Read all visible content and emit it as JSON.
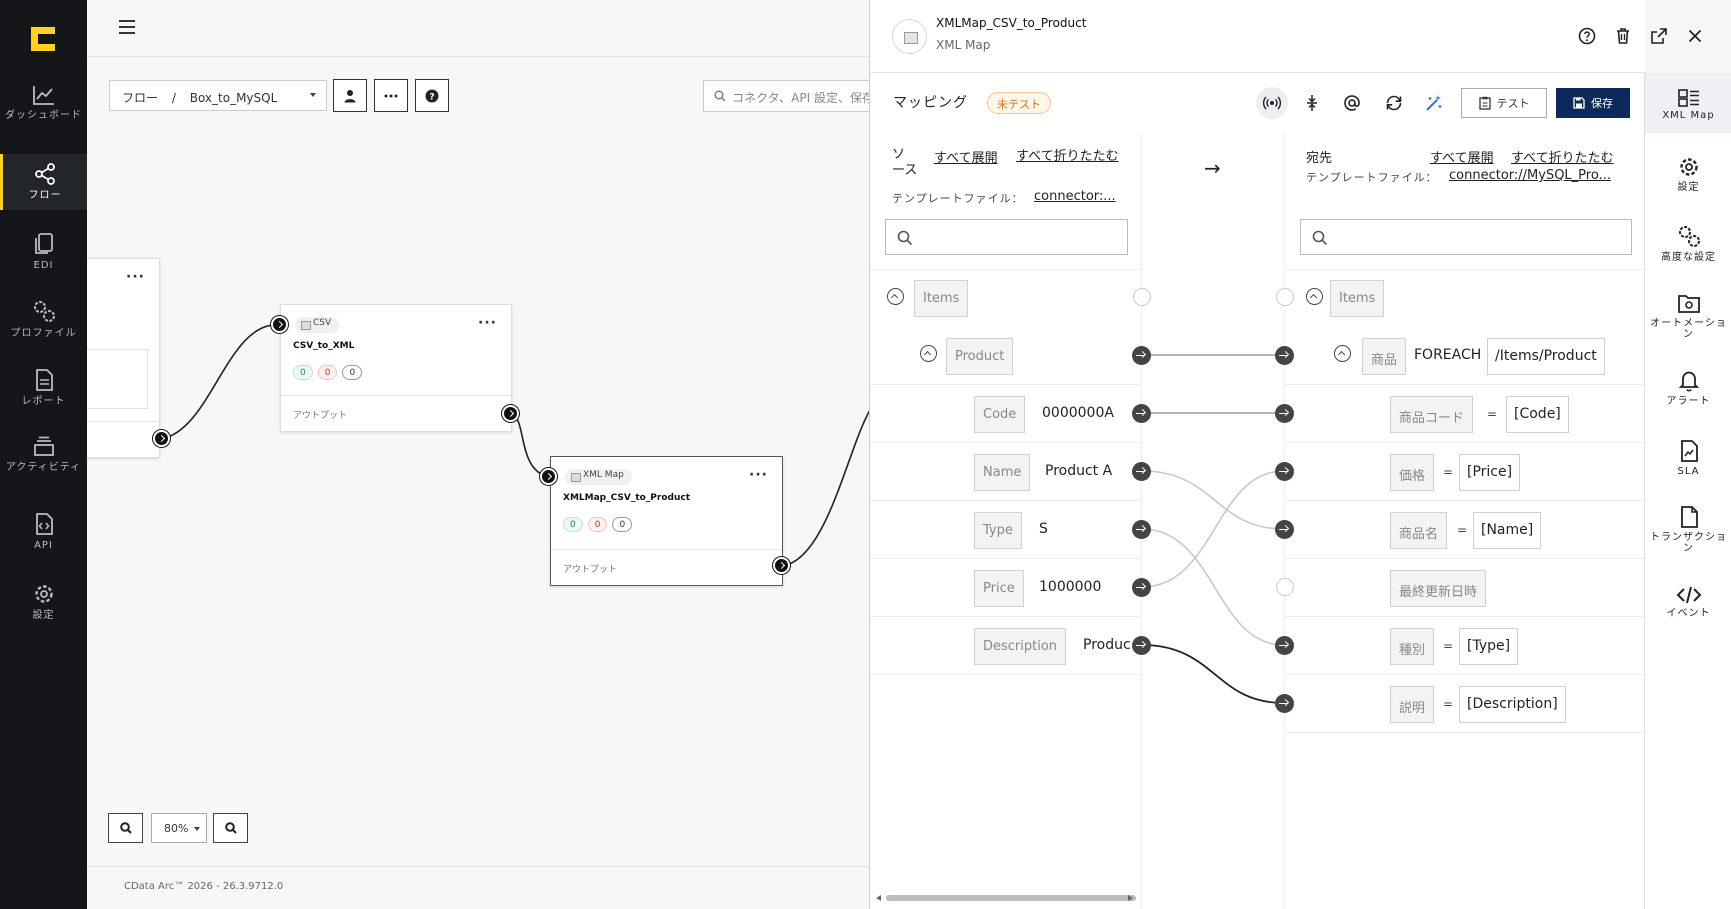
{
  "nav": {
    "items": [
      {
        "label": "ダッシュボード"
      },
      {
        "label": "フロー"
      },
      {
        "label": "EDI"
      },
      {
        "label": "プロファイル"
      },
      {
        "label": "レポート"
      },
      {
        "label": "アクティビティ"
      },
      {
        "label": "API"
      },
      {
        "label": "設定"
      }
    ],
    "active": "フロー"
  },
  "canvas": {
    "breadcrumb": {
      "root": "フロー",
      "separator": "/",
      "flow": "Box_to_MySQL"
    },
    "search_placeholder": "コネクタ、API 設定、保存",
    "zoom": "80%",
    "version": "CData Arc™ 2026 - 26.3.9712.0",
    "nodes": [
      {
        "type": "CSV",
        "title": "CSV_to_XML",
        "badges": [
          "0",
          "0",
          "0"
        ],
        "output": "アウトプット"
      },
      {
        "type": "XML Map",
        "title": "XMLMap_CSV_to_Product",
        "badges": [
          "0",
          "0",
          "0"
        ],
        "output": "アウトプット"
      }
    ]
  },
  "drawer": {
    "title": "XMLMap_CSV_to_Product",
    "subtitle": "XML Map",
    "mapping_title": "マッピング",
    "status_badge": "未テスト",
    "test_label": "テスト",
    "save_label": "保存",
    "source": {
      "heading": "ソース",
      "expand_all": "すべて展開",
      "collapse_all": "すべて折りたたむ",
      "template_label": "テンプレートファイル：",
      "template_value": "connector:..."
    },
    "arrow": "→",
    "destination": {
      "heading": "宛先",
      "expand_all": "すべて展開",
      "collapse_all": "すべて折りたたむ",
      "template_label": "テンプレートファイル：",
      "template_value": "connector://MySQL_Pro..."
    },
    "source_rows": [
      {
        "tag": "Items",
        "value": ""
      },
      {
        "tag": "Product",
        "value": ""
      },
      {
        "tag": "Code",
        "value": "0000000A"
      },
      {
        "tag": "Name",
        "value": "Product A"
      },
      {
        "tag": "Type",
        "value": "S"
      },
      {
        "tag": "Price",
        "value": "1000000"
      },
      {
        "tag": "Description",
        "value": "Produc"
      }
    ],
    "dest_rows": [
      {
        "tag": "Items"
      },
      {
        "tag": "商品",
        "keyword": "FOREACH",
        "expr": "/Items/Product"
      },
      {
        "tag": "商品コード",
        "eq": "=",
        "expr": "[Code]"
      },
      {
        "tag": "価格",
        "eq": "=",
        "expr": "[Price]"
      },
      {
        "tag": "商品名",
        "eq": "=",
        "expr": "[Name]"
      },
      {
        "tag": "最終更新日時"
      },
      {
        "tag": "種別",
        "eq": "=",
        "expr": "[Type]"
      },
      {
        "tag": "説明",
        "eq": "=",
        "expr": "[Description]"
      }
    ]
  },
  "rail": {
    "items": [
      {
        "label": "XML Map"
      },
      {
        "label": "設定"
      },
      {
        "label": "高度な設定"
      },
      {
        "label": "オートメーション"
      },
      {
        "label": "アラート"
      },
      {
        "label": "SLA"
      },
      {
        "label": "トランザクション"
      },
      {
        "label": "イベント"
      }
    ]
  }
}
